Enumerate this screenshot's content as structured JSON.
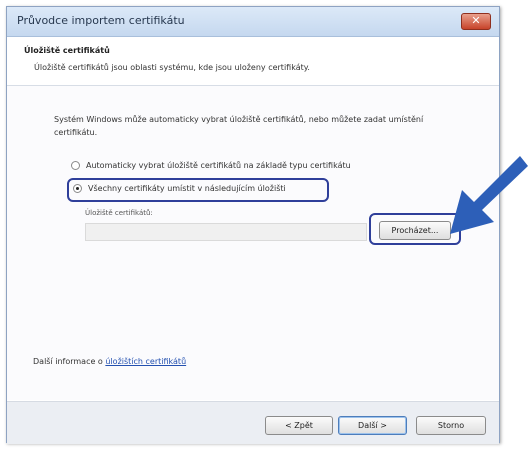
{
  "window": {
    "title": "Průvodce importem certifikátu",
    "close_icon": "close-icon"
  },
  "header": {
    "title": "Úložiště certifikátů",
    "description": "Úložiště certifikátů jsou oblasti systému, kde jsou uloženy certifikáty."
  },
  "body": {
    "intro": "Systém Windows může automaticky vybrat úložiště certifikátů, nebo můžete zadat umístění certifikátu.",
    "options": [
      {
        "label": "Automaticky vybrat úložiště certifikátů na základě typu certifikátu",
        "selected": false
      },
      {
        "label": "Všechny certifikáty umístit v následujícím úložišti",
        "selected": true
      }
    ],
    "store_label": "Úložiště certifikátů:",
    "store_value": "",
    "browse_label": "Procházet...",
    "more_info_prefix": "Další informace o ",
    "more_info_link": "úložištích certifikátů"
  },
  "footer": {
    "back_label": "< Zpět",
    "next_label": "Další >",
    "cancel_label": "Storno"
  },
  "colors": {
    "highlight": "#2f3f9a",
    "arrow": "#2d5fb8"
  }
}
